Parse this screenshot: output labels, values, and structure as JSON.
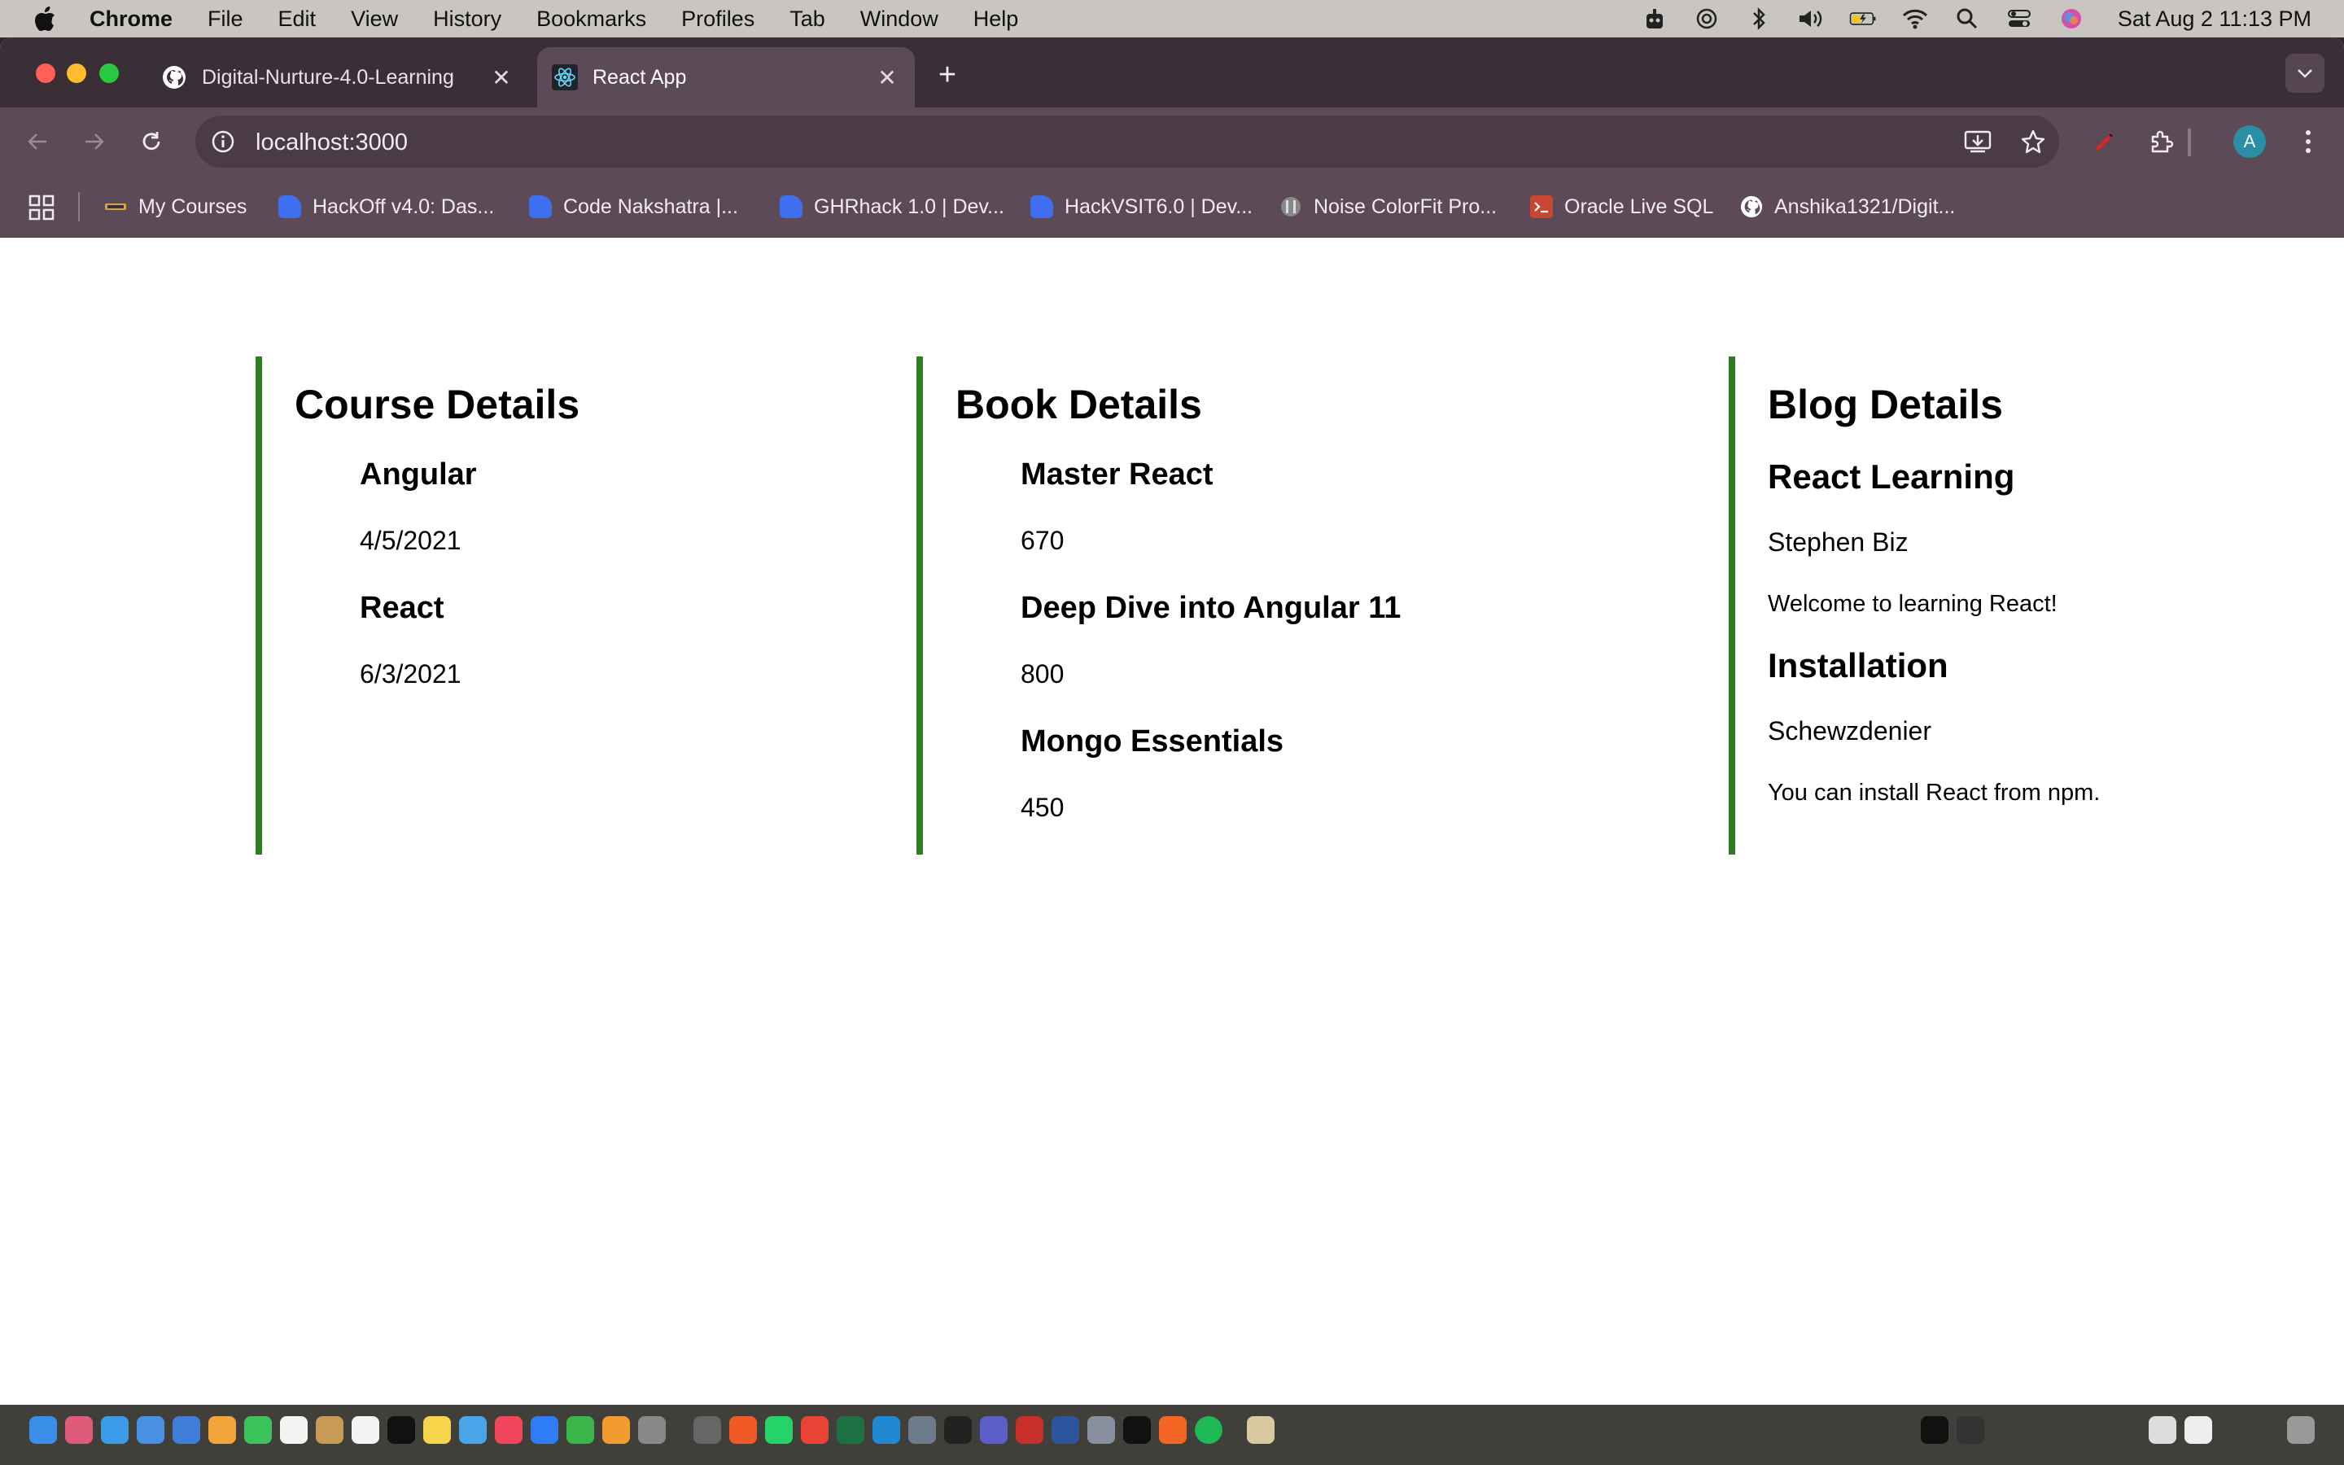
{
  "menubar": {
    "app": "Chrome",
    "items": [
      "File",
      "Edit",
      "View",
      "History",
      "Bookmarks",
      "Profiles",
      "Tab",
      "Window",
      "Help"
    ],
    "clock": "Sat Aug 2  11:13 PM"
  },
  "browser": {
    "tabs": [
      {
        "title": "Digital-Nurture-4.0-Learning",
        "icon": "github-icon"
      },
      {
        "title": "React App",
        "icon": "react-icon"
      }
    ],
    "url": "localhost:3000",
    "profile_initial": "A",
    "bookmarks": [
      {
        "label": "My Courses",
        "icon": "courses-icon"
      },
      {
        "label": "HackOff v4.0: Das...",
        "icon": "devfolio-icon"
      },
      {
        "label": "Code Nakshatra |...",
        "icon": "devfolio-icon"
      },
      {
        "label": "GHRhack 1.0 | Dev...",
        "icon": "devfolio-icon"
      },
      {
        "label": "HackVSIT6.0 | Dev...",
        "icon": "devfolio-icon"
      },
      {
        "label": "Noise ColorFit Pro...",
        "icon": "noise-icon"
      },
      {
        "label": "Oracle Live SQL",
        "icon": "oracle-icon"
      },
      {
        "label": "Anshika1321/Digit...",
        "icon": "github-icon"
      }
    ]
  },
  "course": {
    "heading": "Course Details",
    "items": [
      {
        "name": "Angular",
        "date": "4/5/2021"
      },
      {
        "name": "React",
        "date": "6/3/2021"
      }
    ]
  },
  "book": {
    "heading": "Book Details",
    "items": [
      {
        "name": "Master React",
        "price": "670"
      },
      {
        "name": "Deep Dive into Angular 11",
        "price": "800"
      },
      {
        "name": "Mongo Essentials",
        "price": "450"
      }
    ]
  },
  "blog": {
    "heading": "Blog Details",
    "items": [
      {
        "title": "React Learning",
        "author": "Stephen Biz",
        "content": "Welcome to learning React!"
      },
      {
        "title": "Installation",
        "author": "Schewzdenier",
        "content": "You can install React from npm."
      }
    ]
  },
  "colors": {
    "accent_border": "#2e7d1f",
    "browser_frame": "#5c4a57",
    "tabstrip": "#3a2f37"
  }
}
